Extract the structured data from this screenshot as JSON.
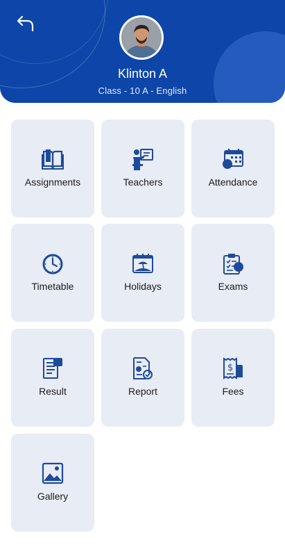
{
  "profile": {
    "name": "Klinton A",
    "class_info": "Class - 10 A - English"
  },
  "colors": {
    "brand": "#0d46a8",
    "tile_bg": "#e8ecf5",
    "icon": "#1e4a9a"
  },
  "icons": {
    "back": "back-arrow-icon",
    "avatar": "user-photo"
  },
  "menu": [
    {
      "label": "Assignments",
      "icon": "book-icon"
    },
    {
      "label": "Teachers",
      "icon": "teacher-board-icon"
    },
    {
      "label": "Attendance",
      "icon": "calendar-user-icon"
    },
    {
      "label": "Timetable",
      "icon": "clock-icon"
    },
    {
      "label": "Holidays",
      "icon": "beach-calendar-icon"
    },
    {
      "label": "Exams",
      "icon": "clipboard-checklist-icon"
    },
    {
      "label": "Result",
      "icon": "result-sheet-icon"
    },
    {
      "label": "Report",
      "icon": "report-document-icon"
    },
    {
      "label": "Fees",
      "icon": "fees-receipt-icon"
    },
    {
      "label": "Gallery",
      "icon": "image-gallery-icon"
    }
  ]
}
